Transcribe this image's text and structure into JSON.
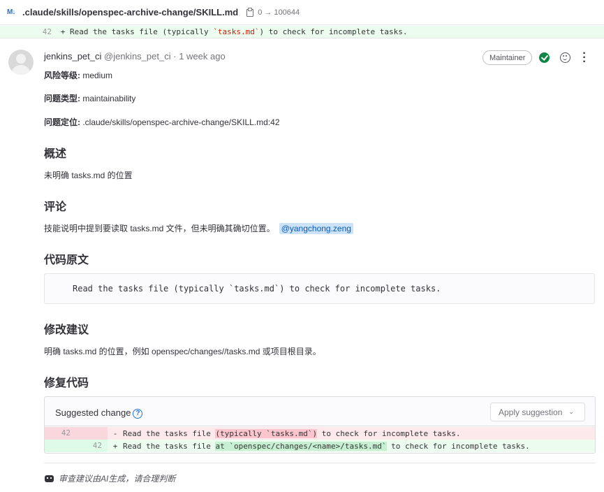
{
  "file": {
    "path": ".claude/skills/openspec-archive-change/SKILL.md",
    "mode_change": "0 → 100644"
  },
  "top_diff": {
    "line_number": "42",
    "sign": "+",
    "code_before": "Read the tasks file (typically ",
    "code_string": "`tasks.md`",
    "code_after": ") to check for incomplete tasks."
  },
  "note": {
    "author": "jenkins_pet_ci",
    "username": "@jenkins_pet_ci",
    "separator": "·",
    "time": "1 week ago",
    "role_badge": "Maintainer",
    "risk_label": "风险等级:",
    "risk_value": " medium",
    "type_label": "问题类型:",
    "type_value": " maintainability",
    "location_label": "问题定位:",
    "location_value": " .claude/skills/openspec-archive-change/SKILL.md:42",
    "overview_title": "概述",
    "overview_text": "未明确 tasks.md 的位置",
    "comment_title": "评论",
    "comment_text": "技能说明中提到要读取 tasks.md 文件，但未明确其确切位置。",
    "mention": "@yangchong.zeng",
    "original_code_title": "代码原文",
    "original_code": "Read the tasks file (typically `tasks.md`) to check for incomplete tasks.",
    "suggestion_title": "修改建议",
    "suggestion_text": "明确 tasks.md 的位置，例如 openspec/changes//tasks.md 或项目根目录。",
    "fix_title": "修复代码"
  },
  "suggestion_box": {
    "title": "Suggested change",
    "help_glyph": "?",
    "apply_label": "Apply suggestion",
    "chevron": "⌄",
    "old_line": {
      "number": "42",
      "sign": "-",
      "pre": "Read the tasks file ",
      "highlight": "(typically `tasks.md`)",
      "post": " to check for incomplete tasks."
    },
    "new_line": {
      "number": "42",
      "sign": "+",
      "pre": "Read the tasks file ",
      "highlight": "at `openspec/changes/<name>/tasks.md`",
      "post": " to check for incomplete tasks."
    }
  },
  "footer": {
    "disclaimer": "审查建议由AI生成，请合理判断"
  },
  "colors": {
    "link": "#1f75cb",
    "resolved": "#108548",
    "added_bg": "#ecfdf0",
    "removed_bg": "#fbe9eb"
  },
  "icons": [
    "file-md-icon",
    "copy-icon",
    "avatar",
    "resolved-check-icon",
    "emoji-icon",
    "more-vertical-icon",
    "help-icon",
    "chevron-down-icon",
    "bot-icon"
  ]
}
